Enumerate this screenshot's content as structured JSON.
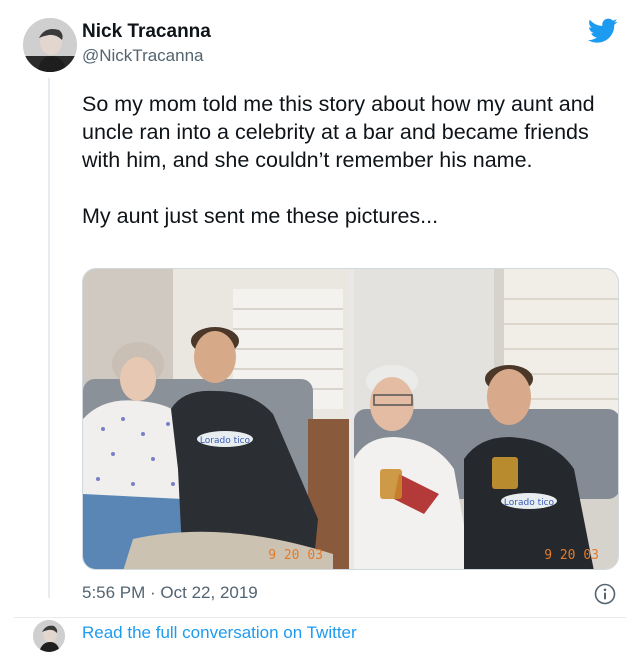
{
  "author": {
    "name": "Nick Tracanna",
    "handle": "@NickTracanna"
  },
  "tweet": {
    "paragraph_1": "So my mom told me this story about how my aunt and uncle ran into a celebrity at a bar and became friends with him, and she couldn’t remember his name.",
    "paragraph_2": "My aunt just sent me these pictures..."
  },
  "photos": {
    "left": {
      "date_stamp": "9 20 03",
      "shirt_text": "Lorado tico"
    },
    "right": {
      "date_stamp": "9 20 03",
      "shirt_text": "Lorado tico"
    }
  },
  "meta": {
    "timestamp": "5:56 PM · Oct 22, 2019"
  },
  "footer": {
    "link_text": "Read the full conversation on Twitter"
  },
  "icons": {
    "brand": "twitter-bird-icon",
    "info": "info-icon"
  },
  "colors": {
    "brand_blue": "#1d9bf0",
    "secondary_text": "#536471"
  }
}
